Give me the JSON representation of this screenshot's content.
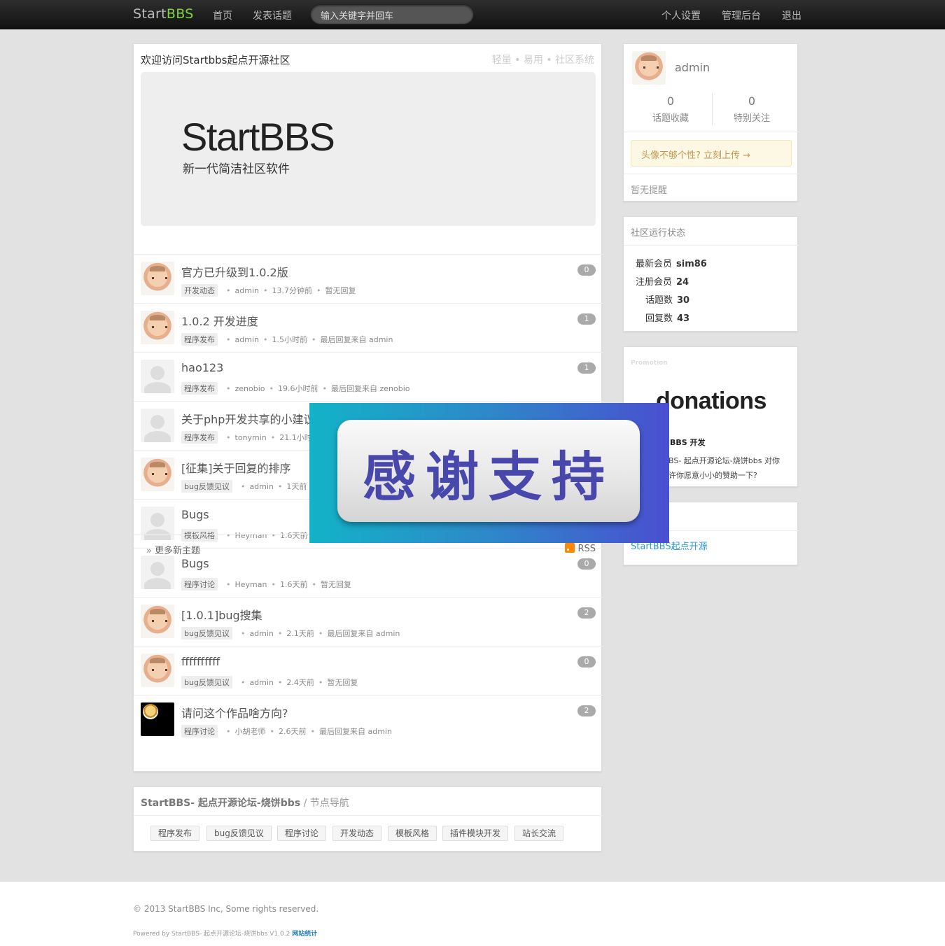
{
  "nav": {
    "brand_start": "Start",
    "brand_bbs": "BBS",
    "links": [
      "首页",
      "发表话题"
    ],
    "search_placeholder": "输入关键字并回车",
    "right_links": [
      "个人设置",
      "管理后台",
      "退出"
    ]
  },
  "welcome": {
    "title": "欢迎访问Startbbs起点开源社区",
    "tags": "轻量 • 易用 • 社区系统",
    "hero_logo": "StartBBS",
    "hero_sub": "新一代简洁社区软件"
  },
  "topics": [
    {
      "avatar": "baby",
      "title": "官方已升级到1.0.2版",
      "tag": "开发动态",
      "user": "admin",
      "time": "13.7分钟前",
      "reply": "暂无回复",
      "count": "0"
    },
    {
      "avatar": "baby",
      "title": "1.0.2 开发进度",
      "tag": "程序发布",
      "user": "admin",
      "time": "1.5小时前",
      "reply": "最后回复来自 admin",
      "count": "1"
    },
    {
      "avatar": "default",
      "title": "hao123",
      "tag": "程序发布",
      "user": "zenobio",
      "time": "19.6小时前",
      "reply": "最后回复来自 zenobio",
      "count": "1"
    },
    {
      "avatar": "default",
      "title": "关于php开发共享的小建议",
      "tag": "程序发布",
      "user": "tonymin",
      "time": "21.1小时前",
      "reply": "",
      "count": ""
    },
    {
      "avatar": "baby",
      "title": "[征集]关于回复的排序",
      "tag": "bug反馈见议",
      "user": "admin",
      "time": "1天前",
      "reply": "",
      "count": ""
    },
    {
      "avatar": "default",
      "title": "Bugs",
      "tag": "模板风格",
      "user": "Heyman",
      "time": "1.6天前",
      "reply": "",
      "count": ""
    },
    {
      "avatar": "default",
      "title": "Bugs",
      "tag": "程序讨论",
      "user": "Heyman",
      "time": "1.6天前",
      "reply": "暂无回复",
      "count": "0"
    },
    {
      "avatar": "baby",
      "title": "[1.0.1]bug搜集",
      "tag": "bug反馈见议",
      "user": "admin",
      "time": "2.1天前",
      "reply": "最后回复来自 admin",
      "count": "2"
    },
    {
      "avatar": "baby",
      "title": "ffffffffff",
      "tag": "bug反馈见议",
      "user": "admin",
      "time": "2.4天前",
      "reply": "暂无回复",
      "count": "0"
    },
    {
      "avatar": "black",
      "title": "请问这个作品啥方向?",
      "tag": "程序讨论",
      "user": "小胡老师",
      "time": "2.6天前",
      "reply": "最后回复来自 admin",
      "count": "2"
    }
  ],
  "more": {
    "label": "更多新主题",
    "rss": "RSS"
  },
  "nodes": {
    "site": "StartBBS- 起点开源论坛-烧饼bbs",
    "label": "/ 节点导航",
    "items": [
      "程序发布",
      "bug反馈见议",
      "程序讨论",
      "开发动态",
      "模板风格",
      "插件模块开发",
      "站长交流"
    ]
  },
  "user": {
    "name": "admin",
    "fav_count": "0",
    "fav_label": "话题收藏",
    "follow_count": "0",
    "follow_label": "特别关注",
    "upload_tip": "头像不够个性? 立刻上传 →",
    "notice": "暂无提醒"
  },
  "status": {
    "title": "社区运行状态",
    "rows": [
      {
        "label": "最新会员",
        "value": "sim86"
      },
      {
        "label": "注册会员",
        "value": "24"
      },
      {
        "label": "话题数",
        "value": "30"
      },
      {
        "label": "回复数",
        "value": "43"
      }
    ]
  },
  "promo": {
    "head": "Promotion",
    "logo": "donations",
    "title": "BBS 开发",
    "text": "BS- 起点开源论坛-烧饼bbs 对你\n许你愿意小小的赞助一下?"
  },
  "links": {
    "item": "StartBBS起点开源"
  },
  "ad": {
    "text": "感谢支持"
  },
  "footer": {
    "copyright": "© 2013 StartBBS Inc, Some rights reserved.",
    "powered": "Powered by StartBBS- 起点开源论坛-烧饼bbs V1.0.2",
    "stat": "网站统计"
  }
}
